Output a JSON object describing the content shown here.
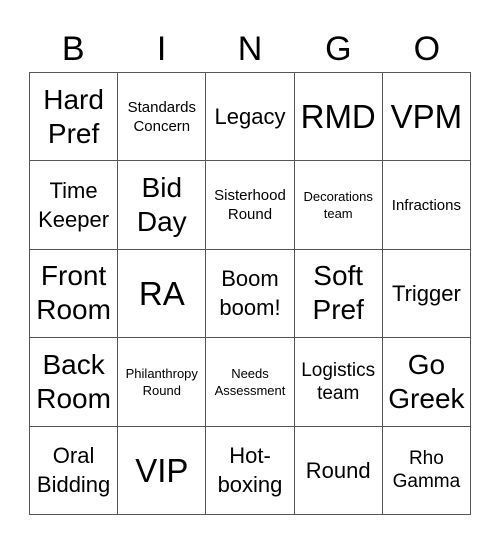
{
  "header": {
    "letters": [
      "B",
      "I",
      "N",
      "G",
      "O"
    ]
  },
  "cells": [
    {
      "text": "Hard\nPref",
      "size": "s-l"
    },
    {
      "text": "Standards\nConcern",
      "size": "s-s"
    },
    {
      "text": "Legacy",
      "size": "s-m"
    },
    {
      "text": "RMD",
      "size": "s-xl"
    },
    {
      "text": "VPM",
      "size": "s-xl"
    },
    {
      "text": "Time\nKeeper",
      "size": "s-m"
    },
    {
      "text": "Bid\nDay",
      "size": "s-l"
    },
    {
      "text": "Sisterhood\nRound",
      "size": "s-s"
    },
    {
      "text": "Decorations\nteam",
      "size": "s-xs"
    },
    {
      "text": "Infractions",
      "size": "s-s"
    },
    {
      "text": "Front\nRoom",
      "size": "s-l"
    },
    {
      "text": "RA",
      "size": "s-xl"
    },
    {
      "text": "Boom\nboom!",
      "size": "s-m"
    },
    {
      "text": "Soft\nPref",
      "size": "s-l"
    },
    {
      "text": "Trigger",
      "size": "s-m"
    },
    {
      "text": "Back\nRoom",
      "size": "s-l"
    },
    {
      "text": "Philanthropy\nRound",
      "size": "s-xs"
    },
    {
      "text": "Needs\nAssessment",
      "size": "s-xs"
    },
    {
      "text": "Logistics\nteam",
      "size": "s-ms"
    },
    {
      "text": "Go\nGreek",
      "size": "s-l"
    },
    {
      "text": "Oral\nBidding",
      "size": "s-m"
    },
    {
      "text": "VIP",
      "size": "s-xl"
    },
    {
      "text": "Hot-\nboxing",
      "size": "s-m"
    },
    {
      "text": "Round",
      "size": "s-m"
    },
    {
      "text": "Rho\nGamma",
      "size": "s-ms"
    }
  ]
}
